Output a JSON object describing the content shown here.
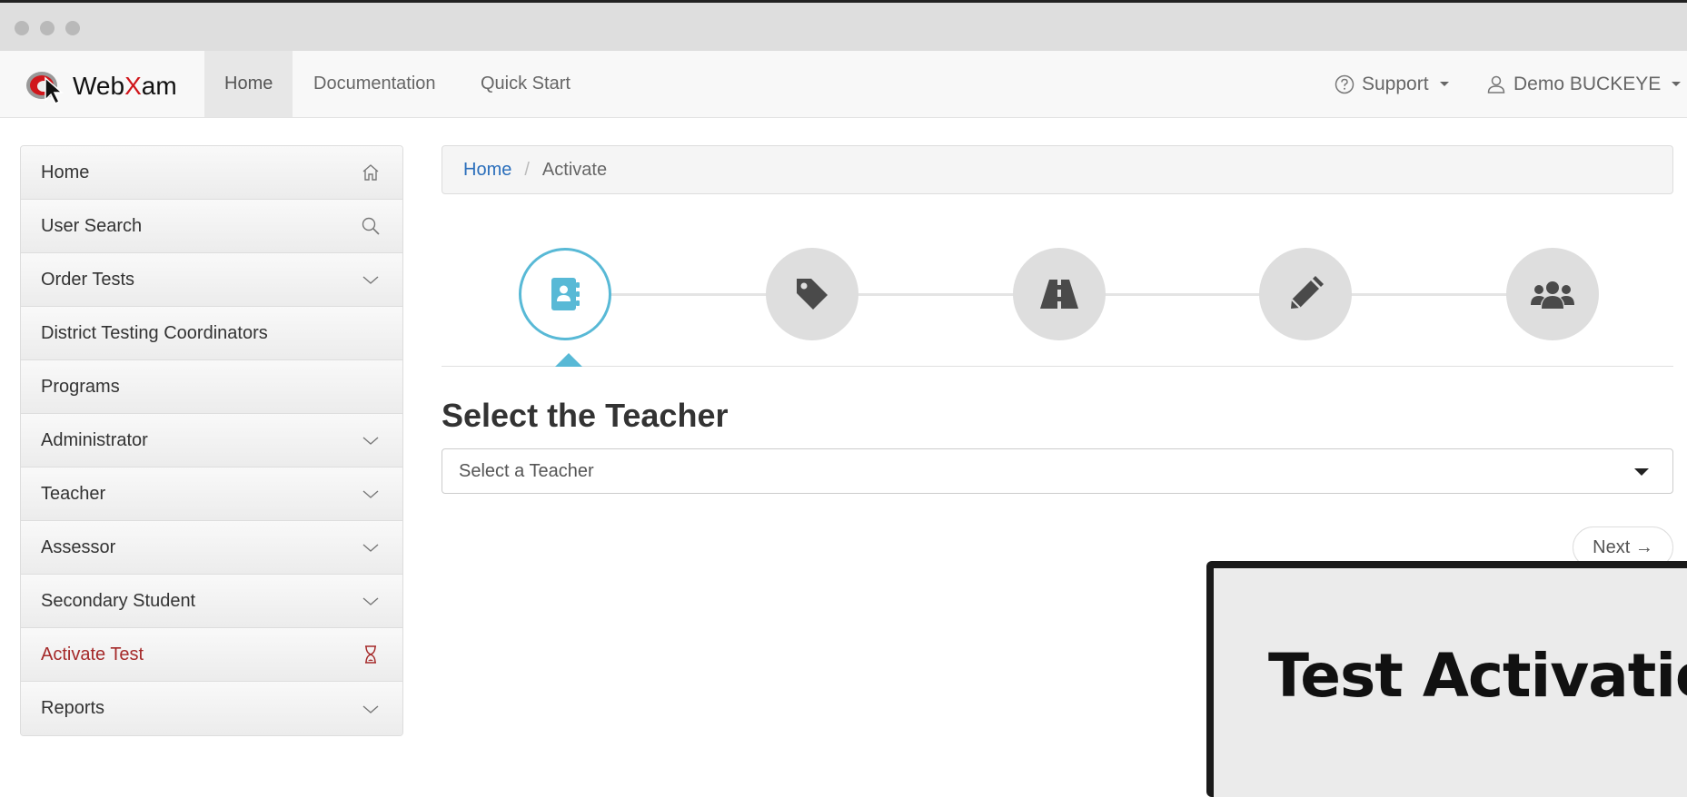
{
  "window": {
    "controls": [
      "close",
      "minimize",
      "maximize"
    ]
  },
  "brand": {
    "name_prefix": "Web",
    "name_accent": "X",
    "name_suffix": "am",
    "accent_color": "#d0161b"
  },
  "nav": {
    "links": [
      {
        "label": "Home",
        "active": true
      },
      {
        "label": "Documentation",
        "active": false
      },
      {
        "label": "Quick Start",
        "active": false
      }
    ],
    "support_label": "Support",
    "user_label": "Demo BUCKEYE"
  },
  "sidebar": {
    "items": [
      {
        "label": "Home",
        "icon": "home-icon"
      },
      {
        "label": "User Search",
        "icon": "search-icon"
      },
      {
        "label": "Order Tests",
        "icon": "chevron-down-icon"
      },
      {
        "label": "District Testing Coordinators",
        "icon": ""
      },
      {
        "label": "Programs",
        "icon": ""
      },
      {
        "label": "Administrator",
        "icon": "chevron-down-icon"
      },
      {
        "label": "Teacher",
        "icon": "chevron-down-icon"
      },
      {
        "label": "Assessor",
        "icon": "chevron-down-icon"
      },
      {
        "label": "Secondary Student",
        "icon": "chevron-down-icon"
      },
      {
        "label": "Activate Test",
        "icon": "hourglass-icon",
        "active": true
      },
      {
        "label": "Reports",
        "icon": "chevron-down-icon"
      }
    ],
    "active_color": "#a52a2a"
  },
  "breadcrumb": {
    "home": "Home",
    "separator": "/",
    "current": "Activate"
  },
  "wizard": {
    "steps": [
      {
        "icon": "contact-book-icon",
        "active": true
      },
      {
        "icon": "tag-icon",
        "active": false
      },
      {
        "icon": "road-icon",
        "active": false
      },
      {
        "icon": "pencil-icon",
        "active": false
      },
      {
        "icon": "users-icon",
        "active": false
      }
    ],
    "active_color": "#58b9d6"
  },
  "main": {
    "title": "Select the Teacher",
    "select_placeholder": "Select a Teacher",
    "next_label": "Next →"
  },
  "overlay": {
    "title": "Test Activation"
  }
}
